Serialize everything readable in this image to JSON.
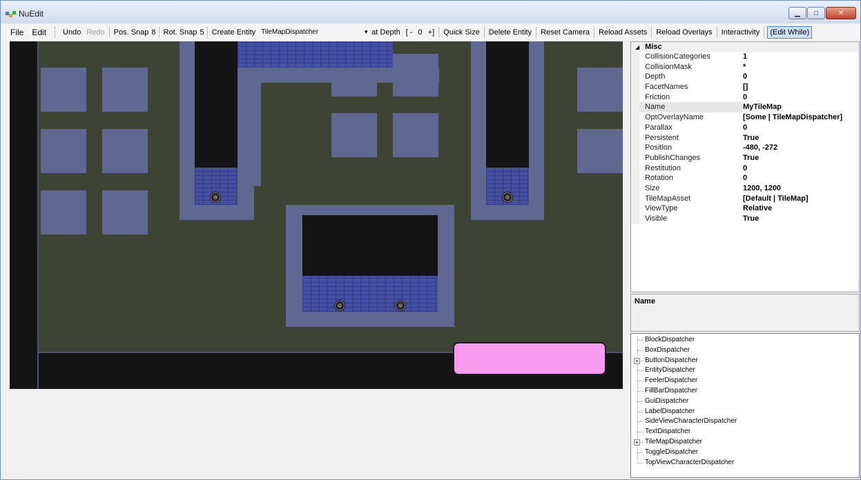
{
  "window": {
    "title": "NuEdit",
    "min_label": "▁",
    "max_label": "□",
    "close_label": "✕"
  },
  "menu": {
    "file": "File",
    "edit": "Edit"
  },
  "toolbar": {
    "undo": "Undo",
    "redo": "Redo",
    "pos_snap_label": "Pos. Snap",
    "pos_snap_value": "8",
    "rot_snap_label": "Rot. Snap",
    "rot_snap_value": "5",
    "create_entity": "Create Entity",
    "entity_combo_value": "TileMapDispatcher",
    "at_depth": "at Depth",
    "depth_minus": "[ -",
    "depth_value": "0",
    "depth_plus": "+]",
    "quick_size": "Quick Size",
    "delete_entity": "Delete Entity",
    "reset_camera": "Reset Camera",
    "reload_assets": "Reload Assets",
    "reload_overlays": "Reload Overlays",
    "interactivity": "Interactivity",
    "edit_while": "(Edit While)"
  },
  "properties": {
    "category": "Misc",
    "rows": [
      {
        "name": "CollisionCategories",
        "value": "1"
      },
      {
        "name": "CollisionMask",
        "value": "*"
      },
      {
        "name": "Depth",
        "value": "0"
      },
      {
        "name": "FacetNames",
        "value": "[]"
      },
      {
        "name": "Friction",
        "value": "0"
      },
      {
        "name": "Name",
        "value": "MyTileMap"
      },
      {
        "name": "OptOverlayName",
        "value": "[Some | TileMapDispatcher]"
      },
      {
        "name": "Parallax",
        "value": "0"
      },
      {
        "name": "Persistent",
        "value": "True"
      },
      {
        "name": "Position",
        "value": "-480, -272"
      },
      {
        "name": "PublishChanges",
        "value": "True"
      },
      {
        "name": "Restitution",
        "value": "0"
      },
      {
        "name": "Rotation",
        "value": "0"
      },
      {
        "name": "Size",
        "value": "1200, 1200"
      },
      {
        "name": "TileMapAsset",
        "value": "[Default | TileMap]"
      },
      {
        "name": "ViewType",
        "value": "Relative"
      },
      {
        "name": "Visible",
        "value": "True"
      }
    ],
    "selected_index": 5
  },
  "help": {
    "title": "Name"
  },
  "tree": {
    "nodes": [
      {
        "label": "BlockDispatcher",
        "expandable": false
      },
      {
        "label": "BoxDispatcher",
        "expandable": false
      },
      {
        "label": "ButtonDispatcher",
        "expandable": true
      },
      {
        "label": "EntityDispatcher",
        "expandable": false
      },
      {
        "label": "FeelerDispatcher",
        "expandable": false
      },
      {
        "label": "FillBarDispatcher",
        "expandable": false
      },
      {
        "label": "GuiDispatcher",
        "expandable": false
      },
      {
        "label": "LabelDispatcher",
        "expandable": false
      },
      {
        "label": "SideViewCharacterDispatcher",
        "expandable": false
      },
      {
        "label": "TextDispatcher",
        "expandable": false
      },
      {
        "label": "TileMapDispatcher",
        "expandable": true
      },
      {
        "label": "ToggleDispatcher",
        "expandable": false
      },
      {
        "label": "TopViewCharacterDispatcher",
        "expandable": false
      }
    ]
  },
  "colors": {
    "ground": "#3d4433",
    "block": "#5f6890",
    "brick": "#454fa3",
    "void": "#141414",
    "pink_box": "#f79bf0"
  }
}
